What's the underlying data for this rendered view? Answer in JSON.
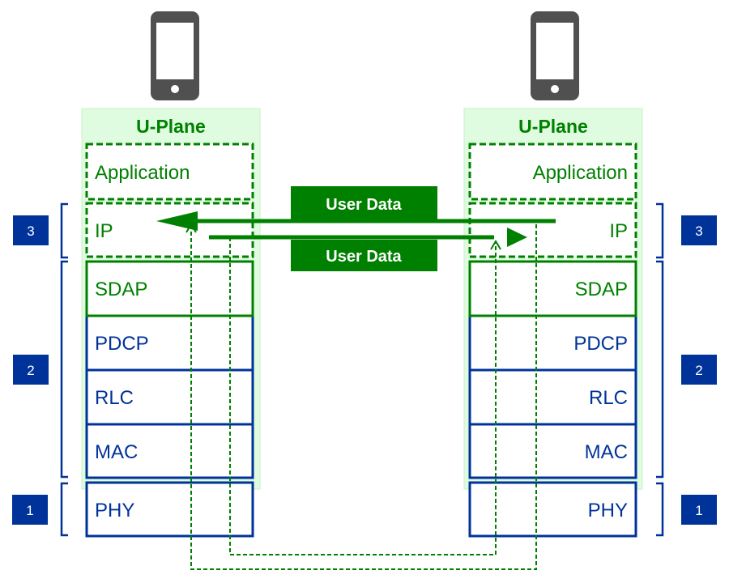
{
  "left_stack": {
    "title": "U-Plane",
    "layers": [
      "Application",
      "IP",
      "SDAP",
      "PDCP",
      "RLC",
      "MAC",
      "PHY"
    ]
  },
  "right_stack": {
    "title": "U-Plane",
    "layers": [
      "Application",
      "IP",
      "SDAP",
      "PDCP",
      "RLC",
      "MAC",
      "PHY"
    ]
  },
  "layer_numbers": [
    "3",
    "2",
    "1"
  ],
  "arrows": {
    "top_label": "User Data",
    "bottom_label": "User Data"
  },
  "icons": [
    "smartphone-icon",
    "smartphone-icon"
  ],
  "colors": {
    "green": "#008000",
    "blue": "#003399",
    "light_green": "#e0fce0",
    "phone": "#505050"
  }
}
